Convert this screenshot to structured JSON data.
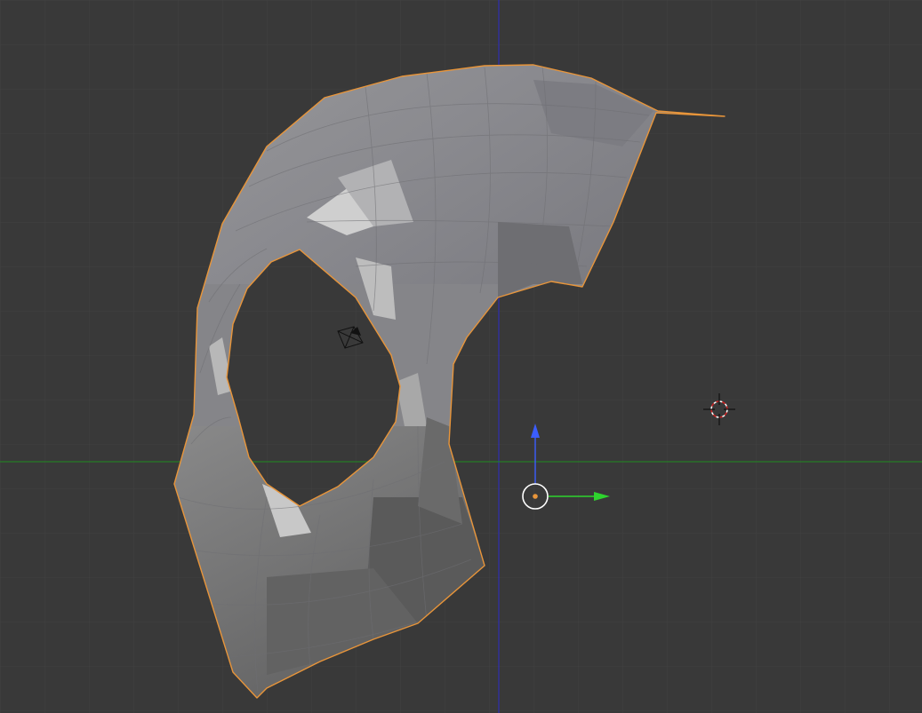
{
  "viewport": {
    "background": "#393939",
    "grid_color": "#414141",
    "axis_x_color": "#1f8a1f",
    "axis_z_color": "#2a2acc",
    "selection_outline": "#e8953a",
    "mesh_base_color": "#8a8a8e"
  },
  "objects": {
    "mesh": {
      "name_icon": "mesh-object",
      "selected": true
    },
    "camera": {
      "icon": "camera-icon"
    },
    "cursor_3d": {
      "icon": "3d-cursor-icon"
    },
    "transform_gizmo": {
      "icon": "transform-gizmo",
      "up_arrow_color": "#3b5dff",
      "right_arrow_color": "#2ed42e",
      "origin_color": "#e8953a"
    }
  }
}
